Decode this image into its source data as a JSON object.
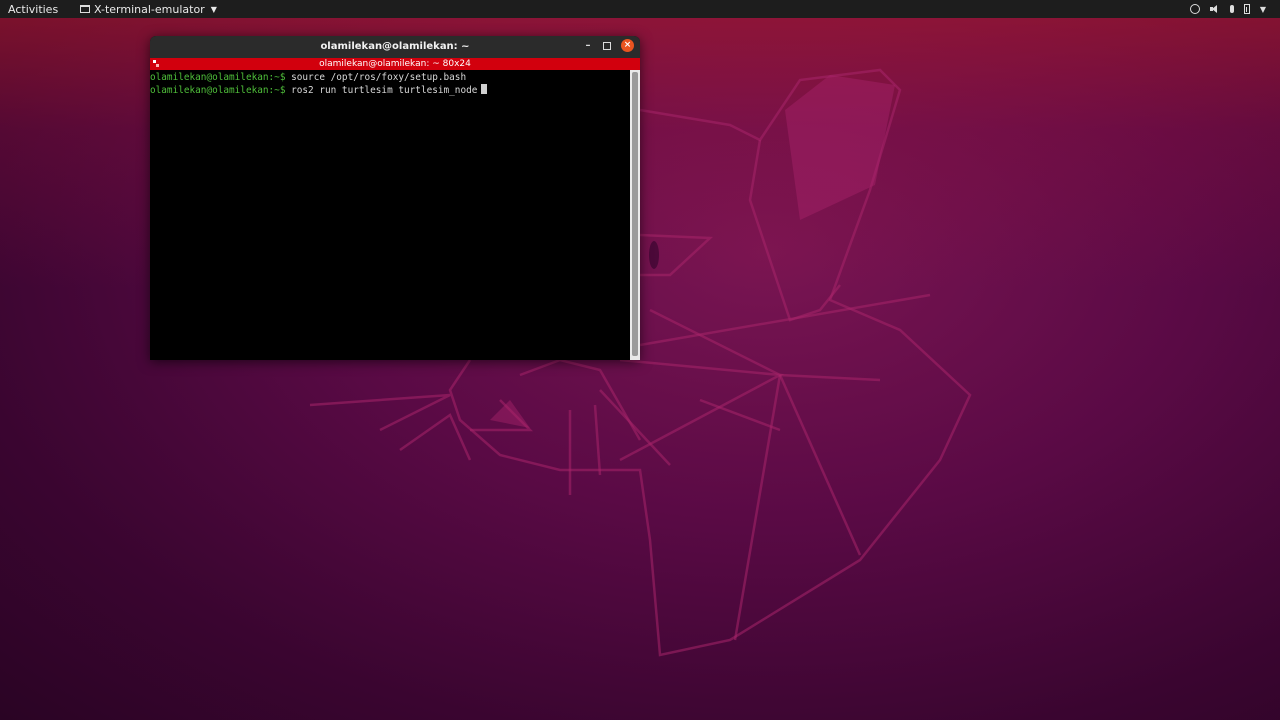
{
  "topbar": {
    "activities_label": "Activities",
    "app_menu_label": "X-terminal-emulator",
    "tray_icons": [
      "network-icon",
      "volume-icon",
      "microphone-icon",
      "battery-icon",
      "chevron-down-icon"
    ]
  },
  "terminal": {
    "title": "olamilekan@olamilekan: ~",
    "tab_title": "olamilekan@olamilekan: ~ 80x24",
    "lines": [
      {
        "prompt": "olamilekan@olamilekan:~$",
        "command": "source /opt/ros/foxy/setup.bash"
      },
      {
        "prompt": "olamilekan@olamilekan:~$",
        "command": "ros2 run turtlesim turtlesim_node"
      }
    ],
    "controls": {
      "minimize": "–",
      "close": "×"
    }
  },
  "colors": {
    "accent": "#e95420",
    "tab_bar": "#d2000d",
    "prompt": "#4fbf3a",
    "wallpaper_base": "#5a0a45"
  }
}
